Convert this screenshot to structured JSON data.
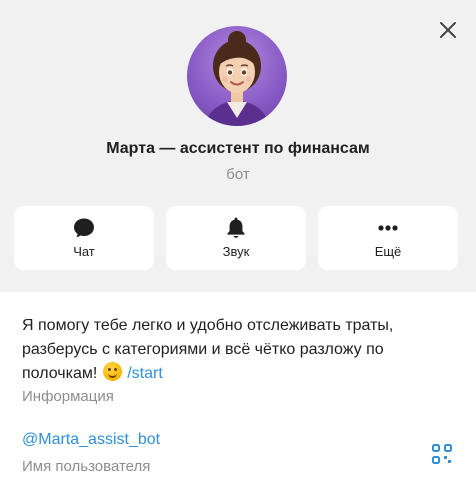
{
  "profile": {
    "name": "Марта — ассистент по финансам",
    "subtitle": "бот"
  },
  "actions": [
    {
      "label": "Чат",
      "icon": "chat-bubble-icon"
    },
    {
      "label": "Звук",
      "icon": "bell-icon"
    },
    {
      "label": "Ещё",
      "icon": "more-dots-icon"
    }
  ],
  "info": {
    "bio_text": "Я помогу тебе легко и удобно отслеживать траты, разберусь с категориями и всё чётко разложу по полочкам!",
    "bio_emoji": "slightly-smiling-face",
    "bio_link": "/start",
    "bio_caption": "Информация",
    "username": "@Marta_assist_bot",
    "username_caption": "Имя пользователя"
  },
  "colors": {
    "accent": "#2f8fd8",
    "header_bg": "#f1f1f1",
    "avatar_bg": "#8a5cc7"
  }
}
